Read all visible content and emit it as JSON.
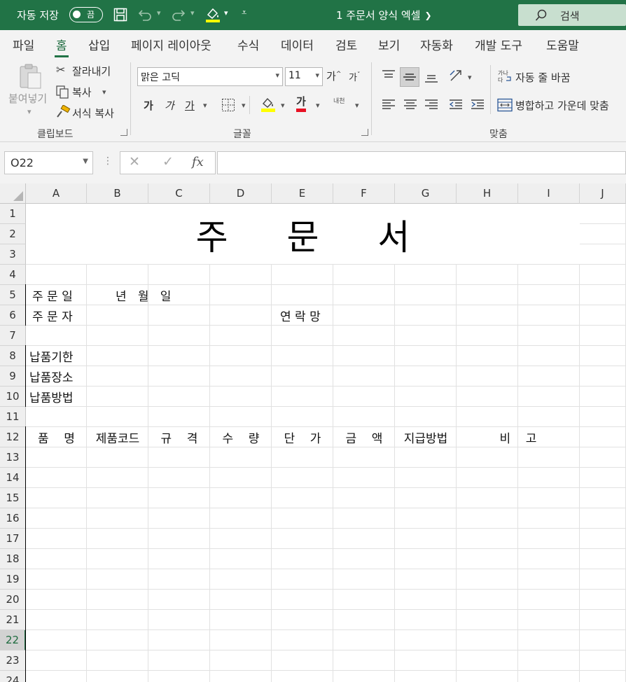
{
  "titlebar": {
    "autosave_label": "자동 저장",
    "autosave_state": "끔",
    "doc_title": "1 주문서 양식 엑셀",
    "search_label": "검색"
  },
  "tabs": [
    "파일",
    "홈",
    "삽입",
    "페이지 레이아웃",
    "수식",
    "데이터",
    "검토",
    "보기",
    "자동화",
    "개발 도구",
    "도움말"
  ],
  "active_tab": "홈",
  "ribbon": {
    "clipboard": {
      "paste": "붙여넣기",
      "cut": "잘라내기",
      "copy": "복사",
      "format_painter": "서식 복사",
      "group_label": "클립보드"
    },
    "font": {
      "font_name": "맑은 고딕",
      "font_size": "11",
      "grow": "가",
      "shrink": "가",
      "bold": "가",
      "italic": "가",
      "underline": "가",
      "font_color_glyph": "가",
      "phonetic": "내천",
      "group_label": "글꼴"
    },
    "alignment": {
      "wrap_text": "자동 줄 바꿈",
      "merge_center": "병합하고 가운데 맞춤",
      "group_label": "맞춤"
    }
  },
  "formula_bar": {
    "name_box": "O22",
    "formula": ""
  },
  "columns": [
    "A",
    "B",
    "C",
    "D",
    "E",
    "F",
    "G",
    "H",
    "I",
    "J"
  ],
  "rows": [
    "1",
    "2",
    "3",
    "4",
    "5",
    "6",
    "7",
    "8",
    "9",
    "10",
    "11",
    "12",
    "13",
    "14",
    "15",
    "16",
    "17",
    "18",
    "19",
    "20",
    "21",
    "22",
    "23",
    "24"
  ],
  "selected_row": "22",
  "sheet": {
    "title": "주 문 서",
    "order_date_label": "주 문 일",
    "order_date_value": "년   월   일",
    "orderer_label": "주 문 자",
    "contact_label": "연 락 망",
    "deadline_label": "납품기한",
    "place_label": "납품장소",
    "method_label": "납품방법",
    "table_headers": [
      "품    명",
      "제품코드",
      "규    격",
      "수    량",
      "단    가",
      "금    액",
      "지급방법",
      "비    고"
    ]
  },
  "colors": {
    "excel_green": "#217346",
    "ribbon_bg": "#f3f3f3",
    "font_color_bar": "#e81123",
    "fill_color_bar": "#ffff00"
  }
}
